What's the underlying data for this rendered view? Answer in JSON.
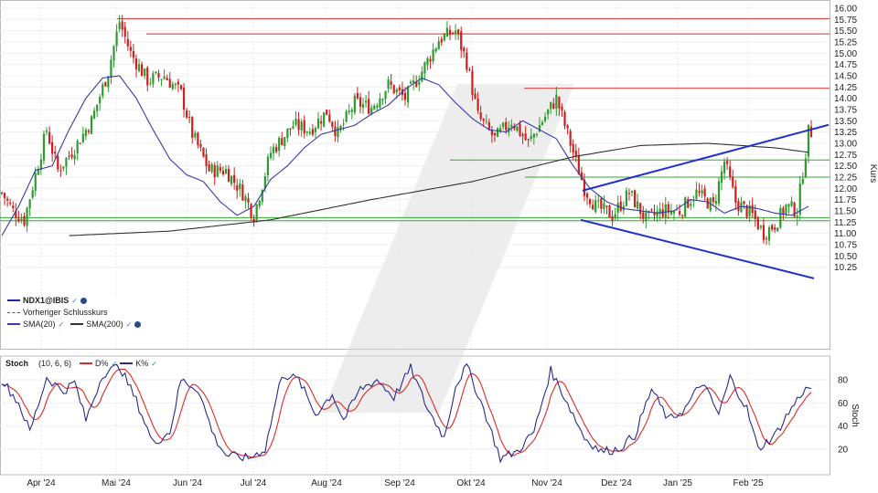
{
  "instrument": "NDX1@IBIS",
  "legend": {
    "prev_close": "Vorheriger Schlusskurs",
    "sma20": "SMA(20)",
    "sma200": "SMA(200)"
  },
  "stoch_legend": {
    "name": "Stoch",
    "params": "(10, 6, 6)",
    "d_label": "D%",
    "k_label": "K%"
  },
  "colors": {
    "up": "#2e9b2e",
    "down": "#cc1f1f",
    "sma20": "#3a3aa8",
    "sma200": "#333333",
    "resistance": "#cc3333",
    "support": "#33aa33",
    "trend": "#1f2fd0",
    "stoch_k": "#2a2a90",
    "stoch_d": "#e02a2a"
  },
  "chart_data": [
    {
      "type": "candlestick",
      "ylabel": "Kurs",
      "ylim": [
        10.0,
        16.0
      ],
      "y_ticks": [
        "16.00",
        "15.75",
        "15.50",
        "15.25",
        "15.00",
        "14.75",
        "14.50",
        "14.25",
        "14.00",
        "13.75",
        "13.50",
        "13.25",
        "13.00",
        "12.75",
        "12.50",
        "12.25",
        "12.00",
        "11.75",
        "11.50",
        "11.25",
        "11.00",
        "10.75",
        "10.50",
        "10.25"
      ],
      "x_ticks": [
        "Apr '24",
        "Mai '24",
        "Jun '24",
        "Jul '24",
        "Aug '24",
        "Sep '24",
        "Okt '24",
        "Nov '24",
        "Dez '24",
        "Jan '25",
        "Feb '25"
      ],
      "horizontal_lines": [
        {
          "kind": "resistance",
          "value": 15.77
        },
        {
          "kind": "resistance",
          "value": 15.43
        },
        {
          "kind": "resistance",
          "value": 14.22
        },
        {
          "kind": "support",
          "value": 12.63
        },
        {
          "kind": "support",
          "value": 12.25
        },
        {
          "kind": "support",
          "value": 11.35
        },
        {
          "kind": "support",
          "value": 11.28
        }
      ],
      "trendlines": [
        {
          "from": [
            "Nov '24",
            11.95
          ],
          "to": [
            "end",
            13.4
          ]
        },
        {
          "from": [
            "Nov '24",
            11.3
          ],
          "to": [
            "end",
            10.0
          ]
        }
      ],
      "series": [
        {
          "name": "SMA(20)",
          "kind": "sma20",
          "path": [
            [
              0,
              10.95
            ],
            [
              6,
              11.6
            ],
            [
              12,
              12.4
            ],
            [
              18,
              12.5
            ],
            [
              24,
              13.3
            ],
            [
              30,
              14.0
            ],
            [
              36,
              14.45
            ],
            [
              42,
              14.5
            ],
            [
              48,
              14.0
            ],
            [
              54,
              13.3
            ],
            [
              60,
              12.65
            ],
            [
              66,
              12.3
            ],
            [
              72,
              12.15
            ],
            [
              78,
              11.7
            ],
            [
              84,
              11.4
            ],
            [
              90,
              11.6
            ],
            [
              96,
              12.2
            ],
            [
              102,
              12.5
            ],
            [
              108,
              12.9
            ],
            [
              114,
              13.2
            ],
            [
              120,
              13.3
            ],
            [
              126,
              13.4
            ],
            [
              132,
              13.65
            ],
            [
              138,
              13.85
            ],
            [
              144,
              14.2
            ],
            [
              150,
              14.45
            ],
            [
              156,
              14.3
            ],
            [
              162,
              13.9
            ],
            [
              168,
              13.55
            ],
            [
              174,
              13.3
            ],
            [
              180,
              13.25
            ],
            [
              186,
              13.5
            ],
            [
              192,
              13.3
            ],
            [
              198,
              13.1
            ],
            [
              204,
              12.5
            ],
            [
              210,
              12.0
            ],
            [
              216,
              11.7
            ],
            [
              222,
              11.55
            ],
            [
              228,
              11.5
            ],
            [
              234,
              11.45
            ],
            [
              240,
              11.5
            ],
            [
              246,
              11.75
            ],
            [
              252,
              11.7
            ],
            [
              258,
              11.45
            ],
            [
              264,
              11.6
            ],
            [
              270,
              11.55
            ],
            [
              276,
              11.45
            ],
            [
              282,
              11.4
            ],
            [
              288,
              11.6
            ]
          ]
        },
        {
          "name": "SMA(200)",
          "kind": "sma200",
          "path": [
            [
              24,
              10.95
            ],
            [
              60,
              11.05
            ],
            [
              96,
              11.3
            ],
            [
              132,
              11.75
            ],
            [
              168,
              12.15
            ],
            [
              204,
              12.7
            ],
            [
              228,
              12.95
            ],
            [
              252,
              13.0
            ],
            [
              276,
              12.9
            ],
            [
              288,
              12.8
            ]
          ]
        }
      ]
    },
    {
      "type": "line",
      "ylabel": "Stoch",
      "ylim": [
        0,
        100
      ],
      "y_ticks": [
        80,
        60,
        40,
        20
      ],
      "series": [
        {
          "name": "K%",
          "kind": "stoch_k"
        },
        {
          "name": "D%",
          "kind": "stoch_d"
        }
      ]
    }
  ]
}
